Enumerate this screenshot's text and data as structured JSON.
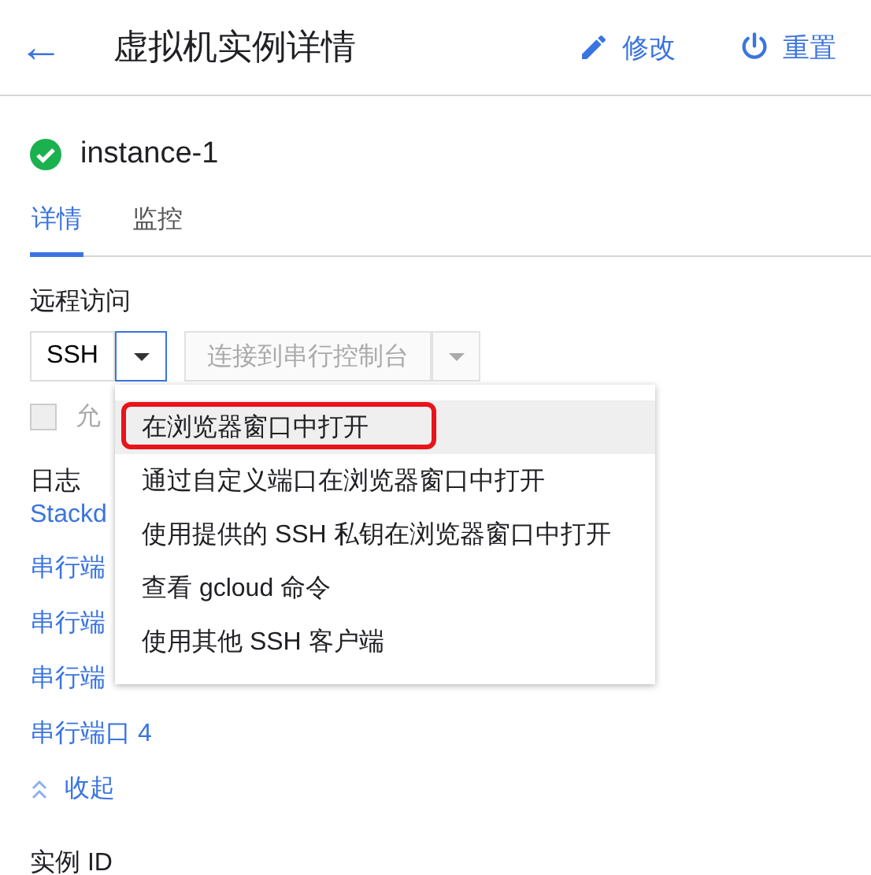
{
  "header": {
    "back_label": "←",
    "title": "虚拟机实例详情",
    "actions": [
      {
        "kind": "edit",
        "label": "修改"
      },
      {
        "kind": "reset",
        "label": "重置"
      }
    ]
  },
  "instance": {
    "name": "instance-1",
    "healthy": true
  },
  "tabs": [
    {
      "label": "详情",
      "selected": true
    },
    {
      "label": "监控",
      "selected": false
    }
  ],
  "remote_access": {
    "label": "远程访问",
    "ssh_button": "SSH",
    "serial_button": {
      "label": "连接到串行控制台",
      "disabled": true
    },
    "checkbox": {
      "label": "允",
      "checked": false,
      "disabled": true
    }
  },
  "menu": {
    "items": [
      {
        "label": "在浏览器窗口中打开",
        "selected": true,
        "outlined": true
      },
      {
        "label": "通过自定义端口在浏览器窗口中打开",
        "selected": false,
        "outlined": false
      },
      {
        "label": "使用提供的 SSH 私钥在浏览器窗口中打开",
        "selected": false,
        "outlined": false
      },
      {
        "label": "查看 gcloud 命令",
        "selected": false,
        "outlined": false
      },
      {
        "label": "使用其他 SSH 客户端",
        "selected": false,
        "outlined": false
      }
    ]
  },
  "logs": {
    "label": "日志",
    "links": [
      "Stackd",
      "串行端",
      "串行端",
      "串行端",
      "串行端口 4"
    ],
    "collapse": "收起"
  },
  "instance_id_label": "实例 ID"
}
